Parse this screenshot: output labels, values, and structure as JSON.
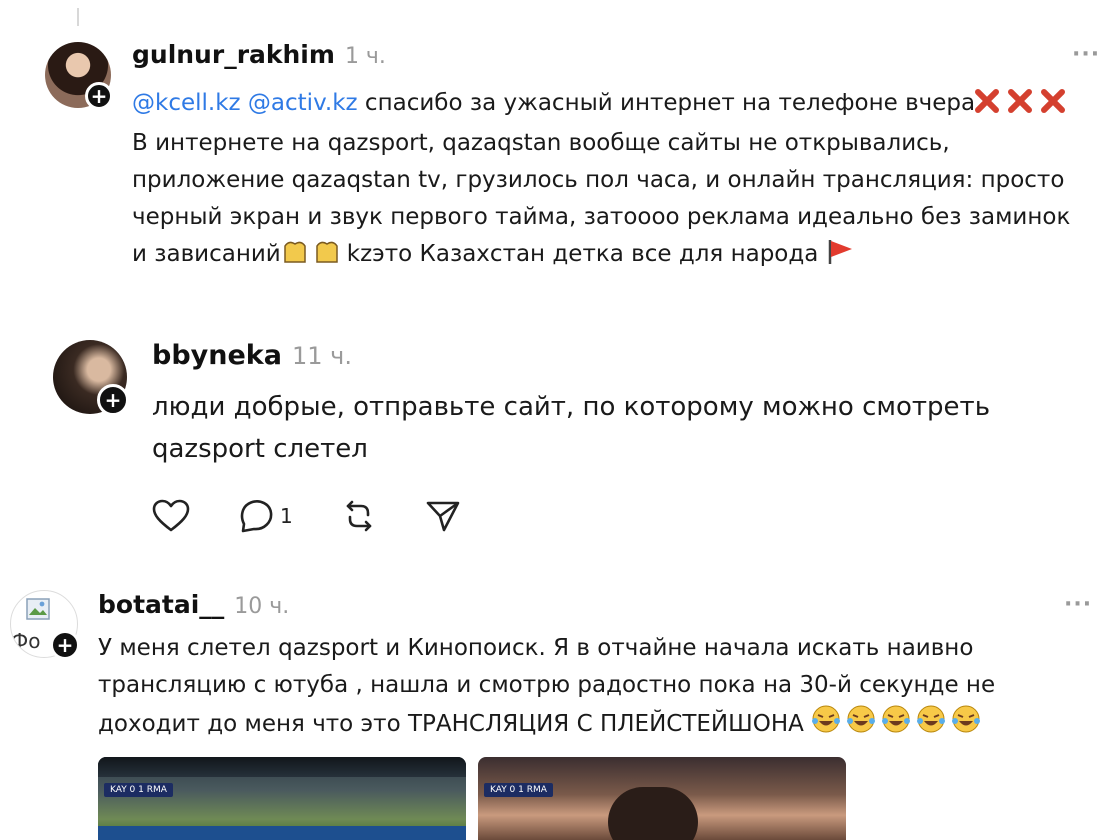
{
  "posts": [
    {
      "username": "gulnur_rakhim",
      "time": "1 ч.",
      "more": "···",
      "mentions": [
        "@kcell.kz",
        "@activ.kz"
      ],
      "line1_text": "спасибо за ужасный интернет на телефоне вчера",
      "line2": "В интернете на qazsport, qazaqstan вообще сайты не открывались,",
      "line3": "приложение qazaqstan tv, грузилось пол часа, и онлайн трансляция: просто",
      "line4": "черный экран и звук первого тайма, затоооо реклама идеально без заминок",
      "line5_a": "и зависаний",
      "line5_b": "kzэто Казахстан детка все для народа"
    },
    {
      "username": "bbyneka",
      "time": "11 ч.",
      "line1": "люди добрые, отправьте сайт, по которому можно смотреть",
      "line2": "qazsport слетел",
      "reply_count": "1"
    },
    {
      "username": "botatai__",
      "time": "10 ч.",
      "more": "···",
      "avatar_alt": "Фо",
      "line1": "У меня слетел qazsport и Кинопоиск. Я в отчайне начала искать наивно",
      "line2": "трансляцию с ютуба , нашла и смотрю радостно пока на 30-й секунде не",
      "line3": "доходит до меня что это ТРАНСЛЯЦИЯ С ПЛЕЙСТЕЙШОНА",
      "thumbnails": [
        {
          "score": "KAY  0  1  RMA"
        },
        {
          "score": "KAY  0  1  RMA"
        }
      ]
    }
  ],
  "icons": [
    "follow-plus-icon",
    "like-icon",
    "reply-icon",
    "repost-icon",
    "share-icon",
    "cross-mark-emoji",
    "raised-hands-emoji",
    "red-flag-emoji",
    "laughing-emoji"
  ],
  "colors": {
    "mention": "#2f7ae5",
    "muted": "#9a9a9a",
    "text": "#1a1a1a"
  }
}
